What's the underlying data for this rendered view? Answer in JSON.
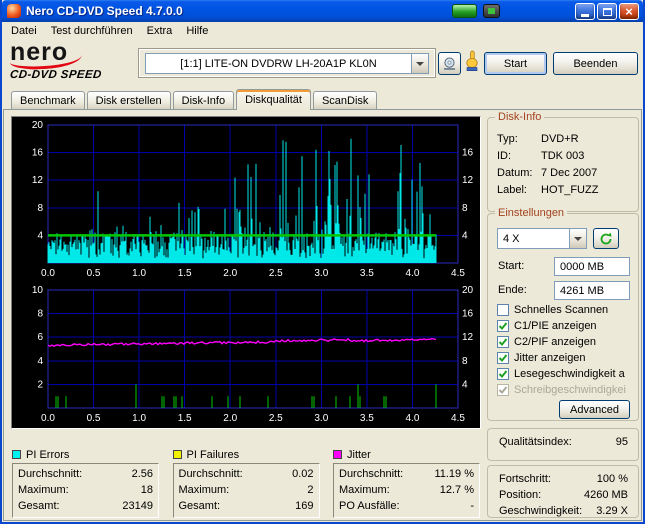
{
  "titlebar": {
    "title": "Nero CD-DVD Speed 4.7.0.0"
  },
  "menu": {
    "items": [
      "Datei",
      "Test durchführen",
      "Extra",
      "Hilfe"
    ]
  },
  "toolbar": {
    "logo_line1": "nero",
    "logo_line2": "CD-DVD SPEED",
    "drive_selector": "[1:1]  LITE-ON DVDRW LH-20A1P KL0N",
    "start_label": "Start",
    "exit_label": "Beenden"
  },
  "tabs": {
    "items": [
      "Benchmark",
      "Disk erstellen",
      "Disk-Info",
      "Diskqualität",
      "ScanDisk"
    ],
    "active": "Diskqualität"
  },
  "disk_info": {
    "title": "Disk-Info",
    "rows": [
      [
        "Typ:",
        "DVD+R"
      ],
      [
        "ID:",
        "TDK 003"
      ],
      [
        "Datum:",
        "7 Dec 2007"
      ],
      [
        "Label:",
        "HOT_FUZZ"
      ]
    ]
  },
  "settings": {
    "title": "Einstellungen",
    "speed_value": "4 X",
    "start_label": "Start:",
    "start_value": "0000 MB",
    "end_label": "Ende:",
    "end_value": "4261 MB",
    "checkboxes": [
      {
        "label": "Schnelles Scannen",
        "checked": false,
        "disabled": false
      },
      {
        "label": "C1/PIE anzeigen",
        "checked": true,
        "disabled": false
      },
      {
        "label": "C2/PIF anzeigen",
        "checked": true,
        "disabled": false
      },
      {
        "label": "Jitter anzeigen",
        "checked": true,
        "disabled": false
      },
      {
        "label": "Lesegeschwindigkeit a",
        "checked": true,
        "disabled": false
      },
      {
        "label": "Schreibgeschwindigkei",
        "checked": true,
        "disabled": true
      }
    ],
    "advanced_label": "Advanced"
  },
  "quality_index": {
    "label": "Qualitätsindex:",
    "value": "95"
  },
  "progress": {
    "rows": [
      [
        "Fortschritt:",
        "100 %"
      ],
      [
        "Position:",
        "4260 MB"
      ],
      [
        "Geschwindigkeit:",
        "3.29 X"
      ]
    ]
  },
  "stats_panels": [
    {
      "name": "PI Errors",
      "color": "#00F0F0",
      "rows": [
        [
          "Durchschnitt:",
          "2.56"
        ],
        [
          "Maximum:",
          "18"
        ],
        [
          "Gesamt:",
          "23149"
        ]
      ]
    },
    {
      "name": "PI Failures",
      "color": "#F2F200",
      "rows": [
        [
          "Durchschnitt:",
          "0.02"
        ],
        [
          "Maximum:",
          "2"
        ],
        [
          "Gesamt:",
          "169"
        ]
      ]
    },
    {
      "name": "Jitter",
      "color": "#FF00FF",
      "rows": [
        [
          "Durchschnitt:",
          "11.19 %"
        ],
        [
          "Maximum:",
          "12.7 %"
        ],
        [
          "PO Ausfälle:",
          "-"
        ]
      ]
    }
  ],
  "chart_data": [
    {
      "type": "area",
      "title": "PI Errors / Lesegeschwindigkeit (Diskqualität-Scan)",
      "x_range": [
        0,
        4.5
      ],
      "x_ticks": [
        "0.0",
        "0.5",
        "1.0",
        "1.5",
        "2.0",
        "2.5",
        "3.0",
        "3.5",
        "4.0",
        "4.5"
      ],
      "x_unit": "GB",
      "data_end_gb": 4.26,
      "y_left_range": [
        0,
        20
      ],
      "y_left_ticks": [
        4,
        8,
        12,
        16,
        20
      ],
      "y_right_ticks": [
        4,
        8,
        12,
        16
      ],
      "grid": true,
      "background": "#000000",
      "grid_color": "#0000A8",
      "series": [
        {
          "name": "PI Errors",
          "color": "#00E8E8",
          "average": 2.56,
          "maximum": 18,
          "total": 23149
        },
        {
          "name": "Lesegeschwindigkeit",
          "color": "#00C800",
          "value": 4,
          "unit": "X"
        }
      ]
    },
    {
      "type": "line",
      "title": "Jitter / PI Failures (Diskqualität-Scan)",
      "x_range": [
        0,
        4.5
      ],
      "x_ticks": [
        "0.0",
        "0.5",
        "1.0",
        "1.5",
        "2.0",
        "2.5",
        "3.0",
        "3.5",
        "4.0",
        "4.5"
      ],
      "x_unit": "GB",
      "data_end_gb": 4.26,
      "y_left_range": [
        0,
        10
      ],
      "y_left_ticks": [
        2,
        4,
        6,
        8,
        10
      ],
      "y_right_range": [
        0,
        20
      ],
      "y_right_ticks": [
        4,
        8,
        12,
        16,
        20
      ],
      "grid": true,
      "background": "#000000",
      "grid_color": "#0000A8",
      "series": [
        {
          "name": "Jitter",
          "axis": "right",
          "color": "#FF00FF",
          "average": 11.19,
          "maximum": 12.7,
          "unit": "%"
        },
        {
          "name": "PI Failures",
          "axis": "left",
          "color": "#00C800",
          "average": 0.02,
          "maximum": 2,
          "total": 169
        }
      ]
    }
  ]
}
